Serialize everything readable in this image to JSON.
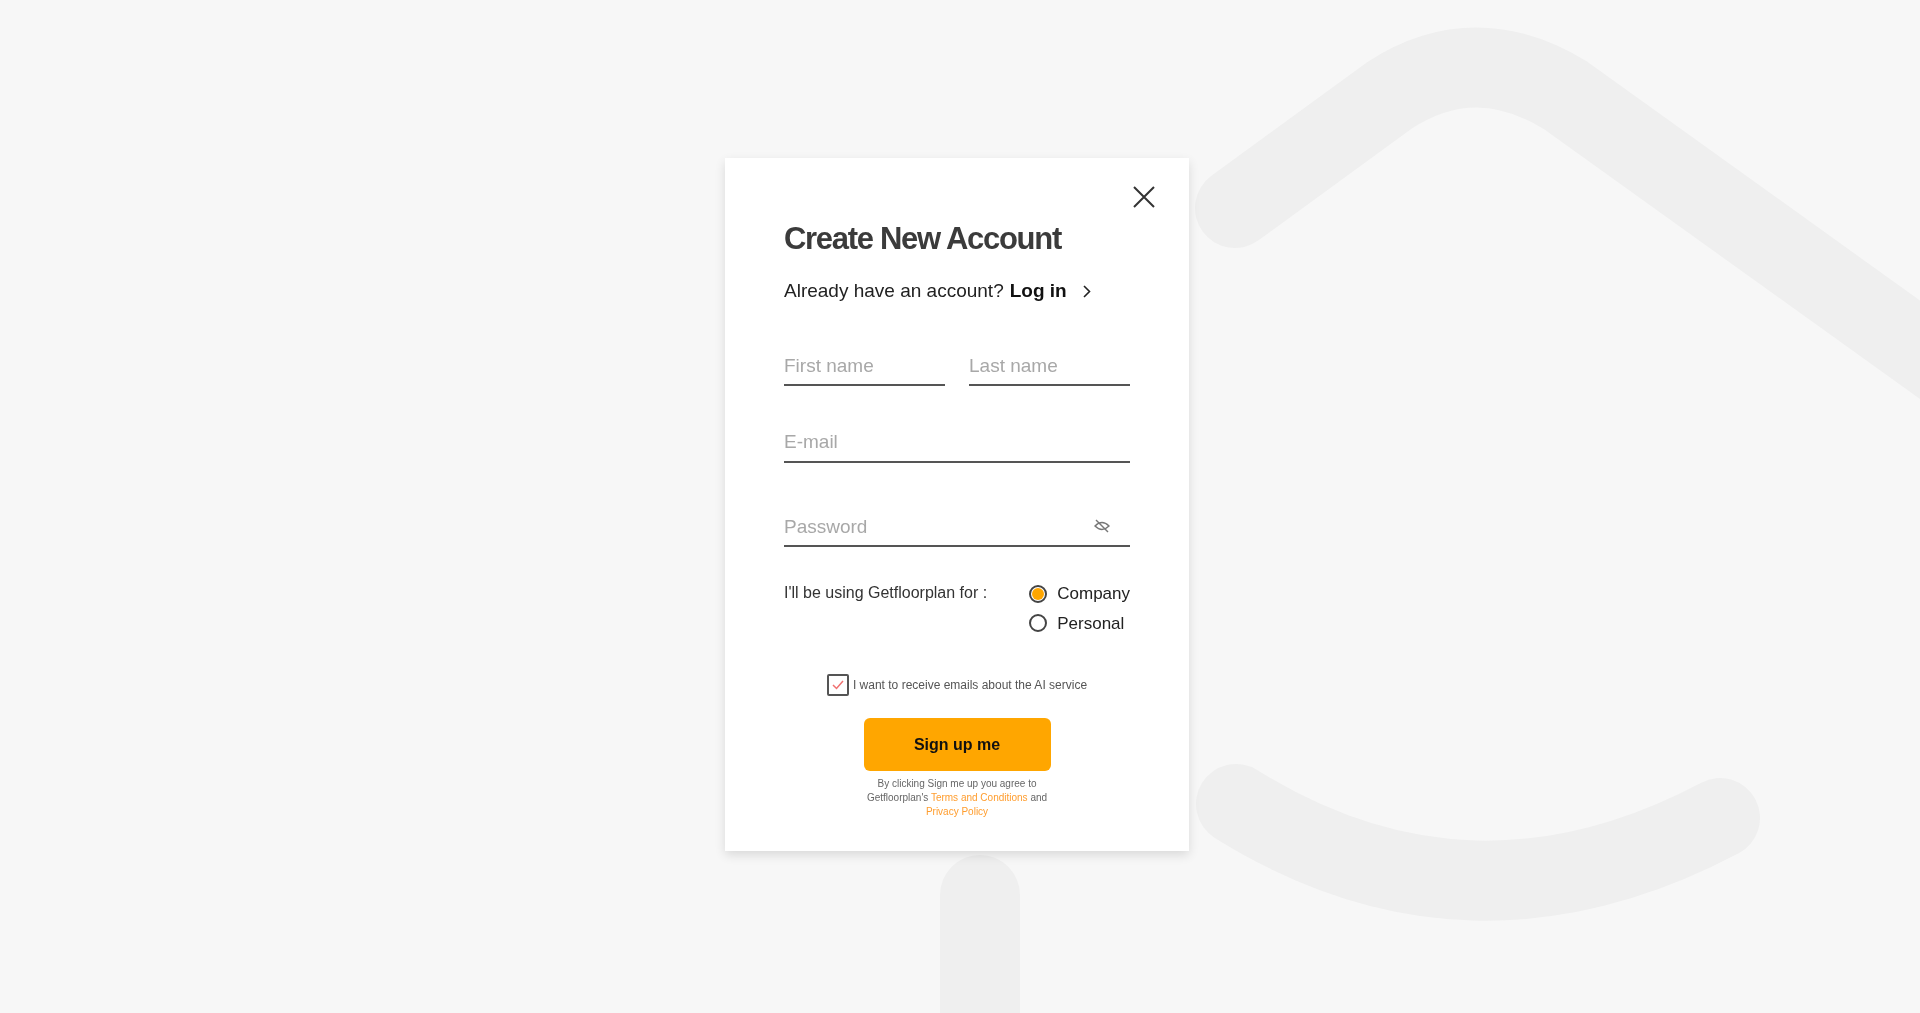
{
  "dialog": {
    "title": "Create New Account",
    "login_prompt": "Already have an account?",
    "login_link": "Log in",
    "name_fields": [
      {
        "placeholder": "First name"
      },
      {
        "placeholder": "Last name"
      }
    ],
    "email": {
      "placeholder": "E-mail"
    },
    "password": {
      "placeholder": "Password",
      "visible": false
    },
    "usage": {
      "label": "I'll be using Getfloorplan for :",
      "options": [
        {
          "label": "Company",
          "selected": true
        },
        {
          "label": "Personal",
          "selected": false
        }
      ]
    },
    "newsletter": {
      "label": "I want to receive emails about the AI service",
      "checked": true
    },
    "submit": "Sign up me",
    "legal": {
      "text_before": "By clicking Sign me up you agree to Getfloorplan's",
      "terms_link": "Terms and Conditions",
      "text_middle": "and",
      "privacy_link": "Privacy Policy"
    }
  }
}
